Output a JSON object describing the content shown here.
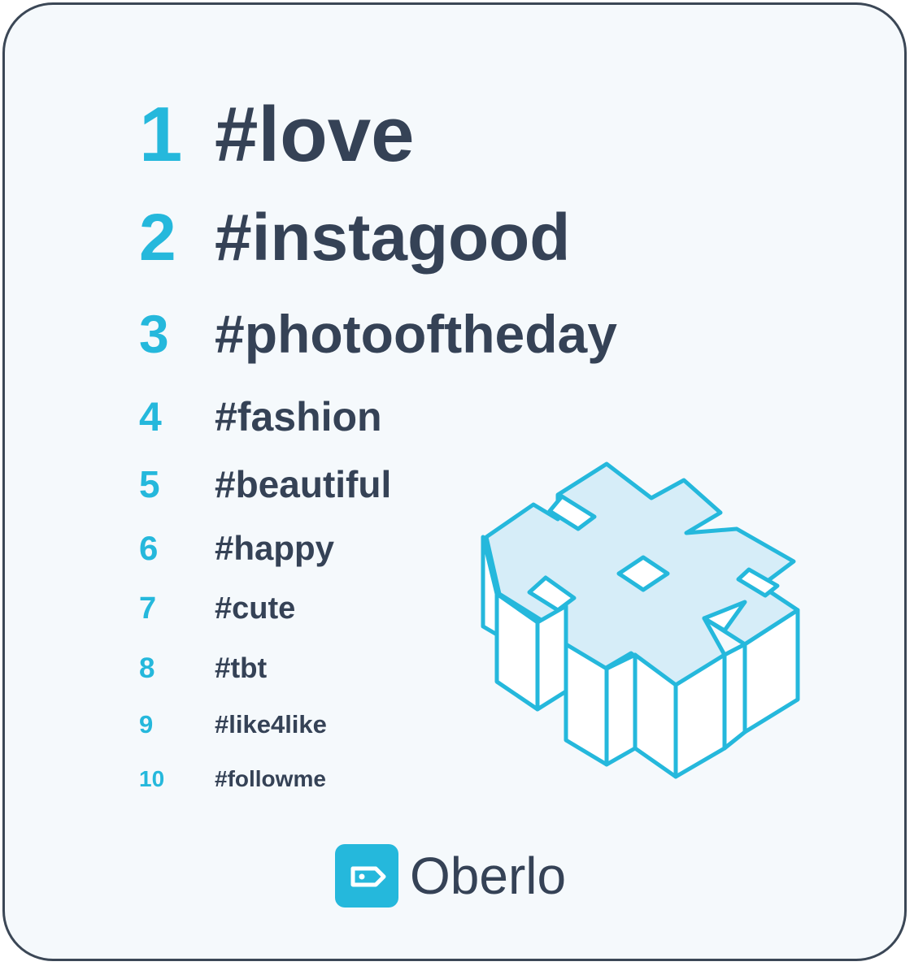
{
  "hashtags": [
    {
      "rank": "1",
      "tag": "#love"
    },
    {
      "rank": "2",
      "tag": "#instagood"
    },
    {
      "rank": "3",
      "tag": "#photooftheday"
    },
    {
      "rank": "4",
      "tag": "#fashion"
    },
    {
      "rank": "5",
      "tag": "#beautiful"
    },
    {
      "rank": "6",
      "tag": "#happy"
    },
    {
      "rank": "7",
      "tag": "#cute"
    },
    {
      "rank": "8",
      "tag": "#tbt"
    },
    {
      "rank": "9",
      "tag": "#like4like"
    },
    {
      "rank": "10",
      "tag": "#followme"
    }
  ],
  "brand": {
    "name": "Oberlo",
    "logo_icon": "price-tag-icon",
    "illustration_icon": "isometric-hashtag-icon"
  },
  "colors": {
    "accent": "#25b8dc",
    "text": "#354256",
    "border": "#3b4756",
    "background": "#f5f9fc",
    "graphic_fill": "#d6edf8"
  }
}
